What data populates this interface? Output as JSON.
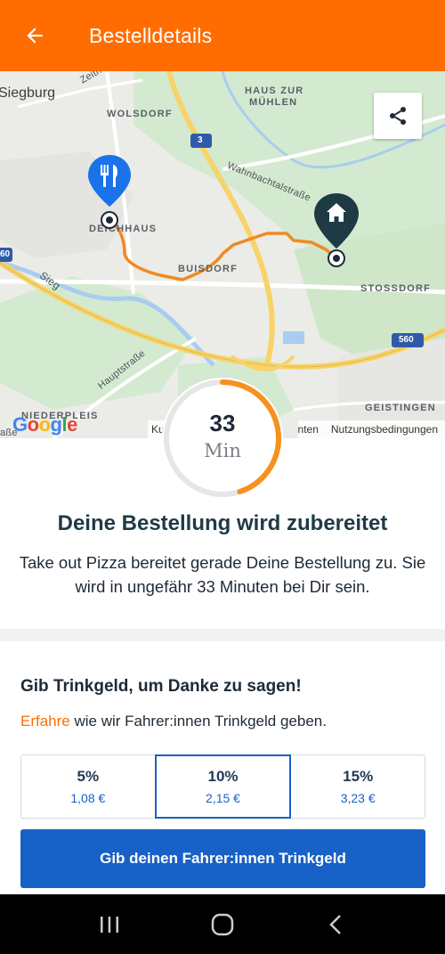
{
  "header": {
    "title": "Bestelldetails",
    "back_icon": "arrow-left-icon"
  },
  "map": {
    "labels": {
      "siegburg": "Siegburg",
      "wolsdorf": "WOLSDORF",
      "haus_zur_muehlen_1": "HAUS ZUR",
      "haus_zur_muehlen_2": "MÜHLEN",
      "deichhaus": "DEICHHAUS",
      "buisdorf": "BUISDORF",
      "stossdorf": "STOSSDORF",
      "geistingen": "GEISTINGEN",
      "niederpleis": "NIEDERPLEIS",
      "wahnbachtal": "Wahnbachtalstraße",
      "hauptstrasse": "Hauptstraße",
      "sieg": "Sieg",
      "zeith": "Zeith",
      "route_3": "3",
      "route_560": "560",
      "route_560_left": "60",
      "strasse_partial": "aße"
    },
    "restaurant_pin_icon": "fork-knife-icon",
    "home_pin_icon": "home-icon",
    "share_icon": "share-icon",
    "google": "Google",
    "attribution_left": "Ku",
    "attribution_mid": "nten",
    "attribution_terms": "Nutzungsbedingungen",
    "colors": {
      "route": "#f08a24",
      "highway": "#f7d36a",
      "restaurant_pin": "#1a73e8",
      "home_pin": "#1e3a45"
    }
  },
  "timer": {
    "value": "33",
    "unit": "Min",
    "progress_fraction": 0.45
  },
  "status": {
    "title": "Deine Bestellung wird zubereitet",
    "description": "Take out Pizza bereitet gerade Deine Bestellung zu. Sie wird in ungefähr 33 Minuten bei Dir sein."
  },
  "tip": {
    "title": "Gib Trinkgeld, um Danke zu sagen!",
    "info_link": "Erfahre",
    "info_rest": " wie wir Fahrer:innen Trinkgeld geben.",
    "options": [
      {
        "percent": "5%",
        "amount": "1,08 €",
        "selected": false
      },
      {
        "percent": "10%",
        "amount": "2,15 €",
        "selected": true
      },
      {
        "percent": "15%",
        "amount": "3,23 €",
        "selected": false
      }
    ],
    "button_label": "Gib deinen Fahrer:innen Trinkgeld"
  },
  "navbar": {
    "recent_icon": "recent-apps-icon",
    "home_icon": "home-circle-icon",
    "back_icon": "back-chevron-icon"
  },
  "theme": {
    "brand_orange": "#ff6d00",
    "primary_blue": "#1761c7",
    "text_dark": "#1e2a36"
  }
}
